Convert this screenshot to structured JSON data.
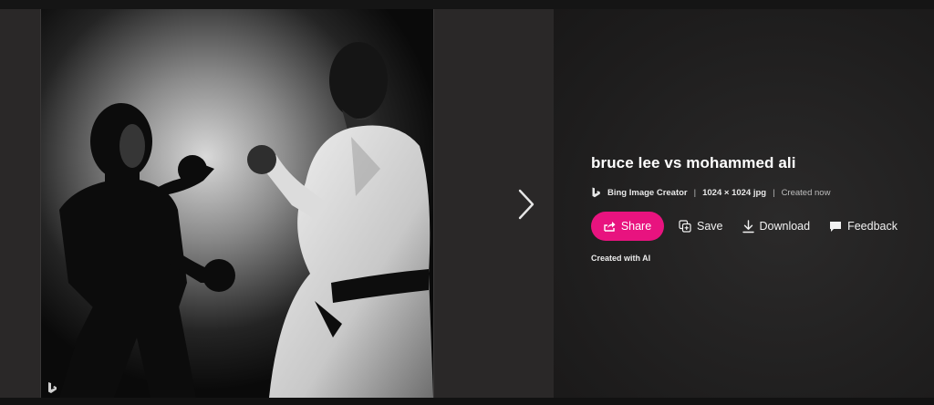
{
  "image": {
    "watermark": "b"
  },
  "details": {
    "title": "bruce lee vs mohammed ali",
    "creator": "Bing Image Creator",
    "size": "1024 × 1024 jpg",
    "created": "Created now",
    "separator": "|",
    "note": "Created with AI"
  },
  "actions": {
    "share": "Share",
    "save": "Save",
    "download": "Download",
    "feedback": "Feedback"
  },
  "colors": {
    "accent": "#e8137f",
    "panel_bg": "#2a2828",
    "details_bg": "#1e1d1d"
  },
  "icons": {
    "share": "share-icon",
    "save": "save-to-collection-icon",
    "download": "download-icon",
    "feedback": "feedback-icon",
    "next": "chevron-right-icon",
    "brand": "bing-icon"
  }
}
